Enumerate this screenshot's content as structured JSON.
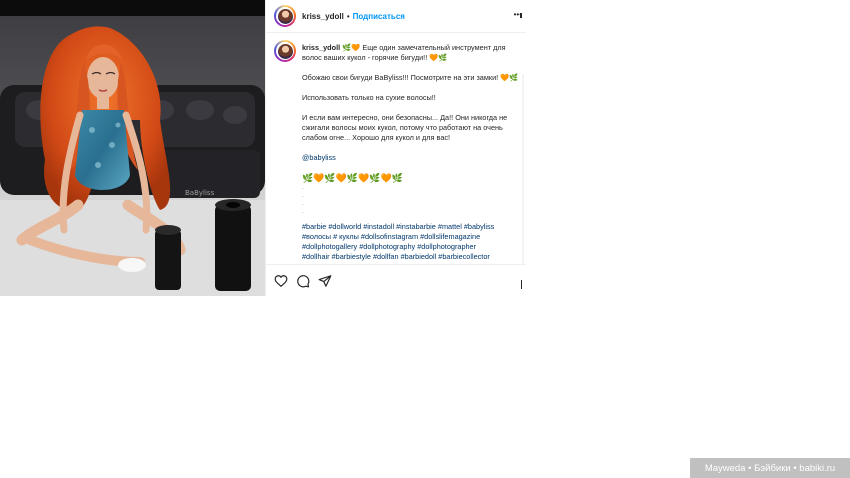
{
  "post": {
    "username": "kriss_ydoll",
    "separator": "•",
    "follow_label": "Подписаться",
    "more_label": "•••"
  },
  "caption": {
    "username": "kriss_ydoll",
    "line1_emoji": "🌿🧡",
    "line1_text": "Еще один замечательный инструмент для волос ваших кукол - горячие бигуди!!",
    "line1_emoji_end": "🧡🌿",
    "para2": "Обожаю свои бигуди BaByliss!!! Посмотрите на эти замки!",
    "para2_emoji": "🧡🌿",
    "para3": "Использовать только на сухие волосы!!",
    "para4": "И если вам интересно, они безопасны... Да!! Они никогда не сжигали волосы моих кукол, потому что работают на очень слабом огне... Хорошо для кукол и для вас!",
    "mention": "@babyliss",
    "emoji_row": "🌿🧡🌿🧡🌿🧡🌿🧡🌿",
    "dots": [
      ".",
      ".",
      ".",
      "."
    ],
    "hashtags_1": "#barbie #dollworld #instadoll #instabarbie #mattel #babyliss",
    "hashtags_2": "#волосы # куклы #dollsofinstagram #dollslifemagazine",
    "hashtags_3": "#dollphotogallery #dollphotography #dollphotographer",
    "hashtags_4": "#dollhair #barbiestyle #dollfan #barbiedoll #barbiecollector"
  },
  "actions": {
    "like_icon": "heart-icon",
    "comment_icon": "comment-icon",
    "share_icon": "send-icon",
    "save_icon": "bookmark-icon"
  },
  "watermark": {
    "text": "Mayweda • Бэйбики • babiki.ru"
  },
  "colors": {
    "follow_blue": "#0095f6",
    "link_blue": "#00376b",
    "hair_orange": "#d9541e",
    "text": "#262626"
  }
}
